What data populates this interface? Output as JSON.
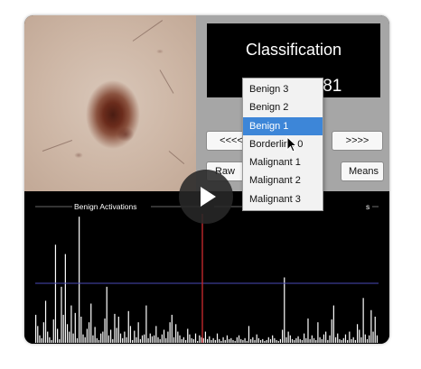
{
  "classification": {
    "title": "Classification",
    "result": "Benign: 0.81"
  },
  "buttons": {
    "prev": "<<<<",
    "next": ">>>>",
    "raw": "Raw",
    "means": "Means"
  },
  "dropdown": {
    "options": [
      "Benign 3",
      "Benign 2",
      "Benign 1",
      "Borderline 0",
      "Malignant 1",
      "Malignant 2",
      "Malignant 3"
    ],
    "selected": "Benign 1"
  },
  "activations": {
    "left_label": "Benign Activations",
    "right_label_partial_left": "M",
    "right_label_partial_right": "s"
  },
  "chart_data": {
    "type": "bar",
    "title": "",
    "xlabel": "",
    "ylabel": "",
    "series": [
      {
        "values": [
          30,
          18,
          8,
          5,
          22,
          45,
          12,
          6,
          3,
          25,
          105,
          15,
          4,
          60,
          30,
          95,
          20,
          12,
          40,
          10,
          32,
          5,
          135,
          28,
          9,
          6,
          15,
          22,
          42,
          8,
          17,
          5,
          3,
          10,
          12,
          26,
          60,
          8,
          14,
          4,
          31,
          16,
          28,
          10,
          5,
          12,
          6,
          34,
          18,
          3,
          13,
          6,
          22,
          4,
          8,
          9,
          40,
          5,
          10,
          7,
          8,
          18,
          6,
          4,
          9,
          14,
          5,
          12,
          22,
          30,
          6,
          20,
          12,
          8,
          4,
          6,
          3,
          15,
          9,
          5,
          4,
          10,
          2,
          8,
          6,
          5,
          12,
          4,
          7,
          3,
          5,
          3,
          10,
          4,
          2,
          6,
          3,
          8,
          4,
          5,
          3,
          2,
          6,
          8,
          4,
          3,
          5,
          2,
          18,
          4,
          6,
          3,
          9,
          5,
          3,
          4,
          2,
          3,
          6,
          4,
          8,
          5,
          3,
          2,
          4,
          14,
          70,
          6,
          12,
          8,
          4,
          3,
          5,
          7,
          4,
          3,
          10,
          5,
          26,
          4,
          8,
          5,
          3,
          22,
          6,
          4,
          9,
          12,
          3,
          8,
          25,
          40,
          6,
          10,
          4,
          3,
          5,
          9,
          3,
          12,
          4,
          6,
          3,
          20,
          14,
          6,
          48,
          9,
          4,
          8,
          35,
          12,
          28,
          8
        ]
      }
    ]
  },
  "colors": {
    "panel_background": "#a6a6a6",
    "selection_highlight": "#3d86d8",
    "reference_line": "#4a4ab8",
    "marker_line": "#c0282c",
    "bars": "#ffffff"
  }
}
